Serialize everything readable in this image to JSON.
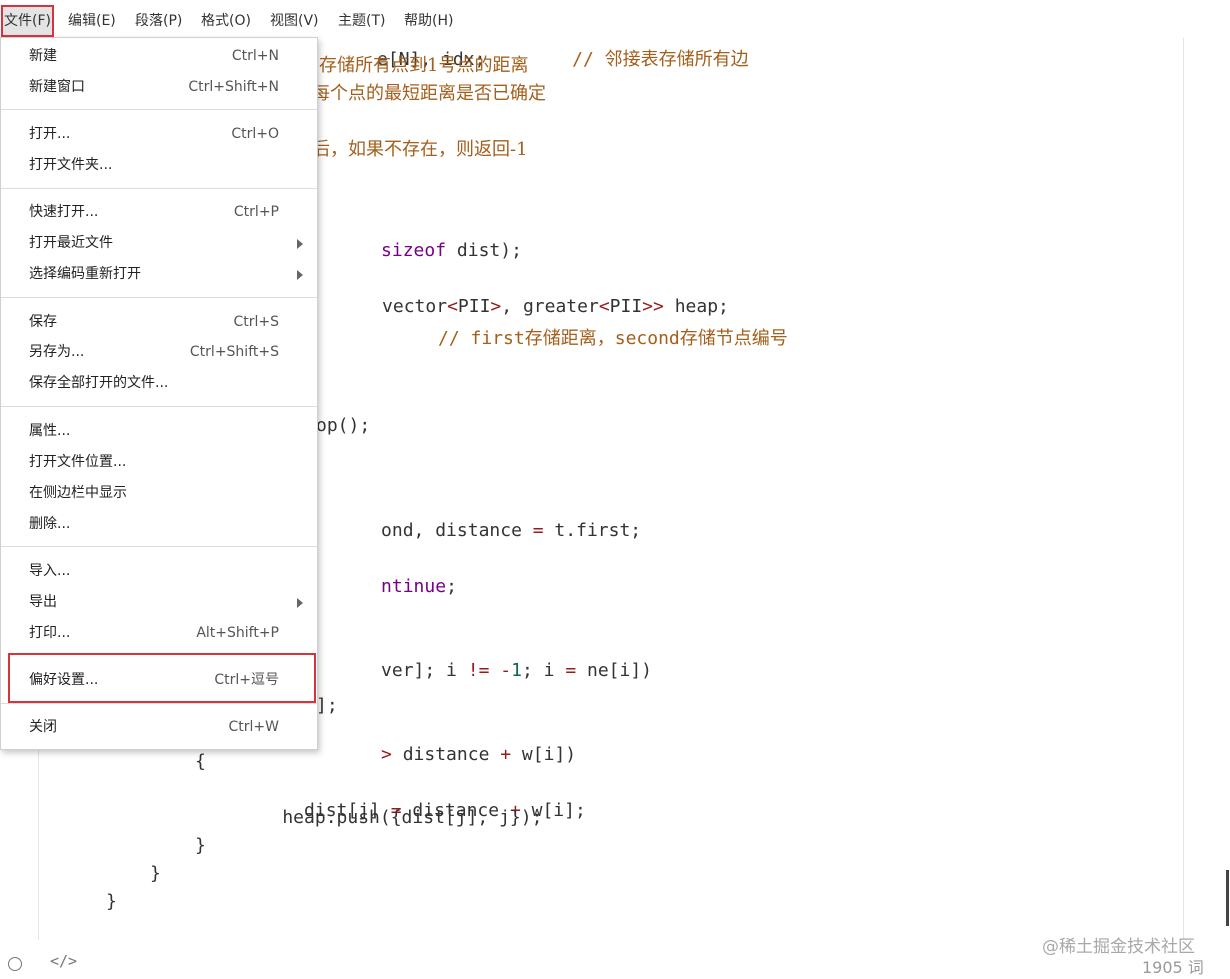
{
  "menubar": {
    "items": [
      "文件(F)",
      "编辑(E)",
      "段落(P)",
      "格式(O)",
      "视图(V)",
      "主题(T)",
      "帮助(H)"
    ]
  },
  "file_menu": {
    "items": [
      {
        "label": "新建",
        "shortcut": "Ctrl+N"
      },
      {
        "label": "新建窗口",
        "shortcut": "Ctrl+Shift+N"
      },
      {
        "label": "打开...",
        "shortcut": "Ctrl+O"
      },
      {
        "label": "打开文件夹...",
        "shortcut": ""
      },
      {
        "label": "快速打开...",
        "shortcut": "Ctrl+P"
      },
      {
        "label": "打开最近文件",
        "shortcut": "",
        "submenu": true
      },
      {
        "label": "选择编码重新打开",
        "shortcut": "",
        "submenu": true
      },
      {
        "label": "保存",
        "shortcut": "Ctrl+S"
      },
      {
        "label": "另存为...",
        "shortcut": "Ctrl+Shift+S"
      },
      {
        "label": "保存全部打开的文件...",
        "shortcut": ""
      },
      {
        "label": "属性...",
        "shortcut": ""
      },
      {
        "label": "打开文件位置...",
        "shortcut": ""
      },
      {
        "label": "在侧边栏中显示",
        "shortcut": ""
      },
      {
        "label": "删除...",
        "shortcut": ""
      },
      {
        "label": "导入...",
        "shortcut": ""
      },
      {
        "label": "导出",
        "shortcut": "",
        "submenu": true
      },
      {
        "label": "打印...",
        "shortcut": "Alt+Shift+P"
      },
      {
        "label": "偏好设置...",
        "shortcut": "Ctrl+逗号"
      },
      {
        "label": "关闭",
        "shortcut": "Ctrl+W"
      }
    ]
  },
  "code_lines": [
    "e[N], idx;        // 邻接表存储所有边",
    "存储所有点到1号点的距离",
    "每个点的最短距离是否已确定",
    "",
    "后，如果不存在，则返回-1",
    "",
    "",
    "sizeof dist);",
    "",
    " vector<PII>, greater<PII>> heap;",
    "     // first存储距离，second存储节点编号",
    "",
    "",
    "",
    "op();",
    "",
    "",
    "ond, distance = t.first;",
    "",
    "ntinue;",
    "",
    "",
    "ver]; i != -1; i = ne[i])",
    "",
    "];",
    " > distance + w[i])",
    "{",
    "    dist[j] = distance + w[i];",
    "    heap.push({dist[j], j});",
    "}",
    "}",
    "}"
  ],
  "status": {
    "code_toggle": "</>",
    "word_count": "1905 词"
  },
  "watermark": "@稀土掘金技术社区",
  "colors": {
    "highlight_border": "#d9323c",
    "keyword": "#770088",
    "operator": "#981a1a",
    "number": "#116644",
    "comment": "#a35f1b"
  }
}
